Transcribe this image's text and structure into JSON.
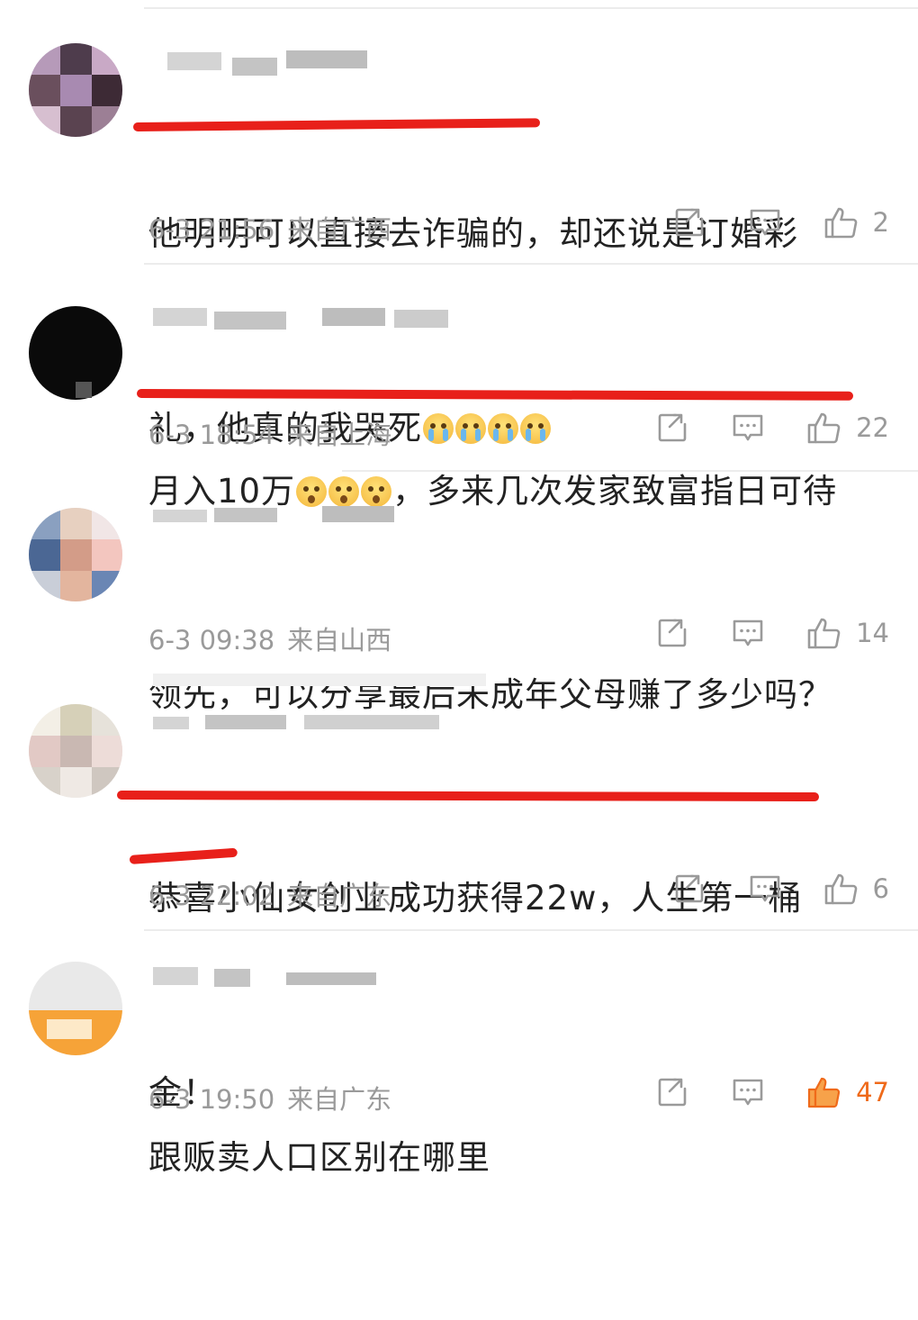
{
  "comments": [
    {
      "text_line1": "他明明可以直接去诈骗的，却还说是订婚彩",
      "text_line2": "礼，他真的我哭死",
      "time": "6-3 21:56",
      "location": "来自广西",
      "likes": "2",
      "liked": false
    },
    {
      "text_before": "月入10万",
      "text_after": "，多来几次发家致富指日可待",
      "time": "6-3 18:54",
      "location": "来自上海",
      "likes": "22",
      "liked": false
    },
    {
      "text": "领先，可以分享最后未成年父母赚了多少吗？",
      "time": "6-3 09:38",
      "location": "来自山西",
      "likes": "14",
      "liked": false
    },
    {
      "text_line1": "恭喜小仙女创业成功获得22w，人生第一桶",
      "text_line2": "金！",
      "time": "6-3 22:02",
      "location": "来自广东",
      "likes": "6",
      "liked": false
    },
    {
      "text": "跟贩卖人口区别在哪里",
      "time": "6-3 19:50",
      "location": "来自广东",
      "likes": "47",
      "liked": true
    }
  ],
  "icons": {
    "share": "share-icon",
    "comment": "comment-icon",
    "like": "thumbs-up-icon"
  },
  "colors": {
    "annotation_red": "#e8201a",
    "meta_gray": "#9a9a9a",
    "liked_orange": "#ef6a1a"
  }
}
